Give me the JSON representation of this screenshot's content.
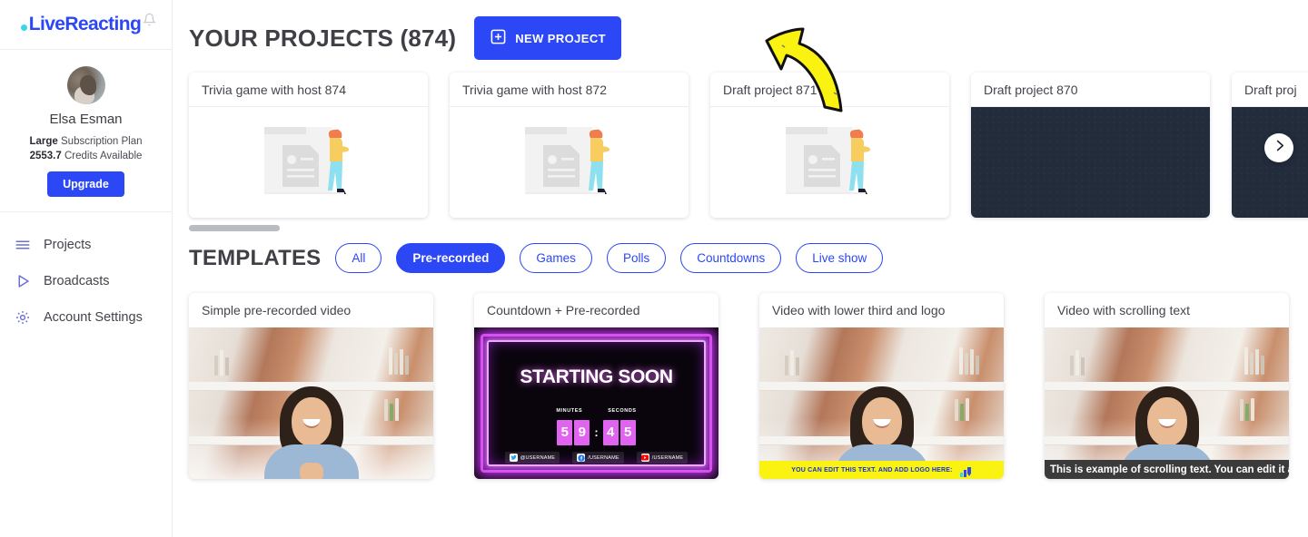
{
  "brand": {
    "name": "LiveReacting",
    "dot_color": "#3ad6e8",
    "text_color": "#2c47f5",
    "bell_icon": "bell-icon"
  },
  "sidebar": {
    "profile": {
      "avatar": "user-avatar",
      "name": "Elsa Esman",
      "plan_value": "Large",
      "plan_label": " Subscription Plan",
      "credits_value": "2553.7",
      "credits_label": " Credits Available",
      "upgrade_label": "Upgrade"
    },
    "nav": [
      {
        "label": "Projects",
        "icon": "hamburger-icon"
      },
      {
        "label": "Broadcasts",
        "icon": "play-triangle-icon"
      },
      {
        "label": "Account Settings",
        "icon": "gear-icon"
      }
    ]
  },
  "projects_section": {
    "title": "YOUR PROJECTS (874)",
    "new_project_label": "NEW PROJECT",
    "new_project_icon": "plus-square-icon",
    "next_icon": "chevron-right-icon",
    "cards": [
      {
        "title": "Trivia game with host 874",
        "thumb": "placeholder-illustration"
      },
      {
        "title": "Trivia game with host 872",
        "thumb": "placeholder-illustration"
      },
      {
        "title": "Draft project 871",
        "thumb": "placeholder-illustration"
      },
      {
        "title": "Draft project 870",
        "thumb": "dark"
      },
      {
        "title": "Draft proj",
        "thumb": "dark"
      }
    ]
  },
  "templates_section": {
    "title": "TEMPLATES",
    "filters": [
      {
        "label": "All",
        "active": false
      },
      {
        "label": "Pre-recorded",
        "active": true
      },
      {
        "label": "Games",
        "active": false
      },
      {
        "label": "Polls",
        "active": false
      },
      {
        "label": "Countdowns",
        "active": false
      },
      {
        "label": "Live show",
        "active": false
      }
    ],
    "cards": [
      {
        "title": "Simple pre-recorded video",
        "art": "webcam"
      },
      {
        "title": "Countdown + Pre-recorded",
        "art": "countdown",
        "countdown": {
          "headline": "STARTING SOON",
          "minutes_label": "MINUTES",
          "seconds_label": "SECONDS",
          "minutes": "59",
          "seconds": "45",
          "socials": [
            {
              "icon": "twitter-icon",
              "handle": "@USERNAME"
            },
            {
              "icon": "facebook-icon",
              "handle": "/USERNAME"
            },
            {
              "icon": "youtube-icon",
              "handle": "/USERNAME"
            }
          ]
        }
      },
      {
        "title": "Video with lower third and logo",
        "art": "lower-third",
        "lower_third_text": "YOU CAN EDIT THIS TEXT. AND ADD LOGO HERE:"
      },
      {
        "title": "Video with scrolling text",
        "art": "scrolling",
        "scrolling_text": "This is example of scrolling text. You can edit it and"
      }
    ]
  },
  "colors": {
    "accent_blue": "#2c47f5",
    "annotation_yellow": "#faf312",
    "dark_thumb": "#222c3a"
  }
}
